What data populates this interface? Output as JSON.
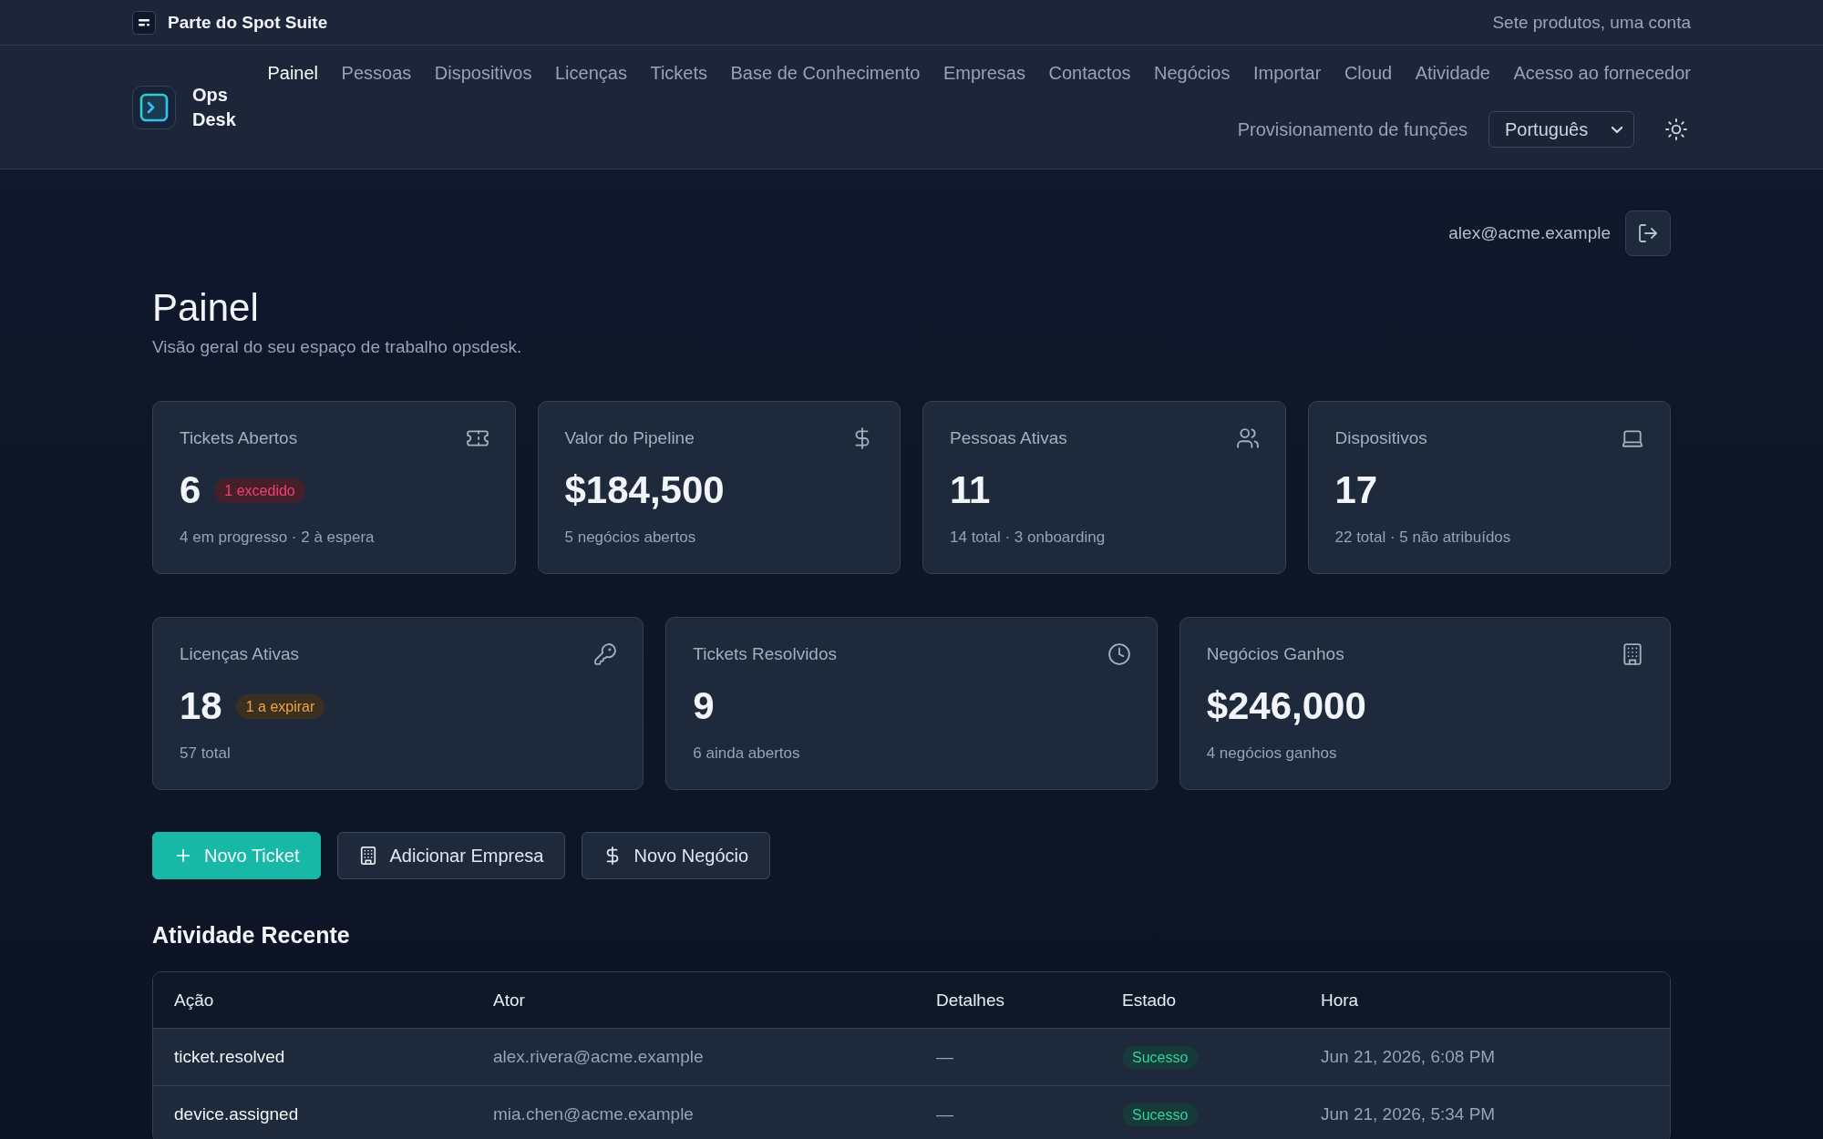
{
  "suite_bar": {
    "title": "Parte do Spot Suite",
    "tagline": "Sete produtos, uma conta"
  },
  "brand": {
    "name": "Ops Desk"
  },
  "nav": {
    "links": [
      {
        "label": "Painel",
        "selected": true
      },
      {
        "label": "Pessoas",
        "selected": false
      },
      {
        "label": "Dispositivos",
        "selected": false
      },
      {
        "label": "Licenças",
        "selected": false
      },
      {
        "label": "Tickets",
        "selected": false
      },
      {
        "label": "Base de Conhecimento",
        "selected": false
      },
      {
        "label": "Empresas",
        "selected": false
      },
      {
        "label": "Contactos",
        "selected": false
      },
      {
        "label": "Negócios",
        "selected": false
      },
      {
        "label": "Importar",
        "selected": false
      },
      {
        "label": "Cloud",
        "selected": false
      },
      {
        "label": "Atividade",
        "selected": false
      },
      {
        "label": "Acesso ao fornecedor",
        "selected": false
      }
    ],
    "secondary_link": "Provisionamento de funções",
    "language_select": {
      "value": "Português"
    }
  },
  "user": {
    "email": "alex@acme.example"
  },
  "page": {
    "title": "Painel",
    "subtitle": "Visão geral do seu espaço de trabalho opsdesk."
  },
  "stat_rows": [
    {
      "cards": [
        {
          "label": "Tickets Abertos",
          "value": "6",
          "badge": {
            "text": "1 excedido",
            "color": "#45202a"
          },
          "note": "4 em progresso · 2 à espera"
        },
        {
          "label": "Valor do Pipeline",
          "value": "$184,500",
          "note": "5 negócios abertos"
        },
        {
          "label": "Pessoas Ativas",
          "value": "11",
          "note": "14 total · 3 onboarding"
        },
        {
          "label": "Dispositivos",
          "value": "17",
          "note": "22 total · 5 não atribuídos"
        }
      ]
    },
    {
      "cards": [
        {
          "label": "Licenças Ativas",
          "value": "18",
          "badge": {
            "text": "1 a expirar",
            "color": "#3b2f20"
          },
          "note": "57 total"
        },
        {
          "label": "Tickets Resolvidos",
          "value": "9",
          "note": "6 ainda abertos"
        },
        {
          "label": "Negócios Ganhos",
          "value": "$246,000",
          "note": "4 negócios ganhos"
        }
      ]
    }
  ],
  "actions": [
    {
      "label": "Novo Ticket",
      "kind": "primary"
    },
    {
      "label": "Adicionar Empresa",
      "kind": "secondary"
    },
    {
      "label": "Novo Negócio",
      "kind": "secondary"
    }
  ],
  "recent_activity": {
    "title": "Atividade Recente",
    "columns": [
      "Ação",
      "Ator",
      "Detalhes",
      "Estado",
      "Hora"
    ],
    "rows": [
      {
        "action": "ticket.resolved",
        "actor": "alex.rivera@acme.example",
        "details": "—",
        "status": "Sucesso",
        "time": "Jun 21, 2026, 6:08 PM"
      },
      {
        "action": "device.assigned",
        "actor": "mia.chen@acme.example",
        "details": "—",
        "status": "Sucesso",
        "time": "Jun 21, 2026, 5:34 PM"
      }
    ]
  }
}
